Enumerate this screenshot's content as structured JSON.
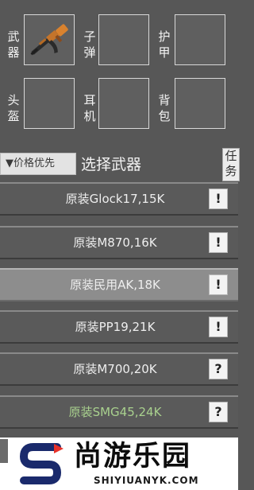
{
  "equipment": {
    "weapon_label": "武器",
    "ammo_label": "子弹",
    "armor_label": "护甲",
    "helmet_label": "头盔",
    "headset_label": "耳机",
    "backpack_label": "背包",
    "weapon_icon": "ak-rifle-icon"
  },
  "toolbar": {
    "sort_label": "▼价格优先",
    "section_title": "选择武器",
    "task_label": "任务"
  },
  "items": [
    {
      "name": "原装Glock17,15K",
      "badge": "!",
      "color": "#eeeeee"
    },
    {
      "name": "原装M870,16K",
      "badge": "!",
      "color": "#eeeeee"
    },
    {
      "name": "原装民用AK,18K",
      "badge": "!",
      "color": "#eeeeee",
      "selected": true
    },
    {
      "name": "原装PP19,21K",
      "badge": "!",
      "color": "#eeeeee"
    },
    {
      "name": "原装M700,20K",
      "badge": "?",
      "color": "#eeeeee"
    },
    {
      "name": "原装SMG45,24K",
      "badge": "?",
      "color": "#a9d18e"
    }
  ],
  "watermark": {
    "brand": "尚游乐园",
    "url": "SHIYIUANYK.COM",
    "accent": "#e8322a",
    "dark": "#1a2a6c"
  }
}
